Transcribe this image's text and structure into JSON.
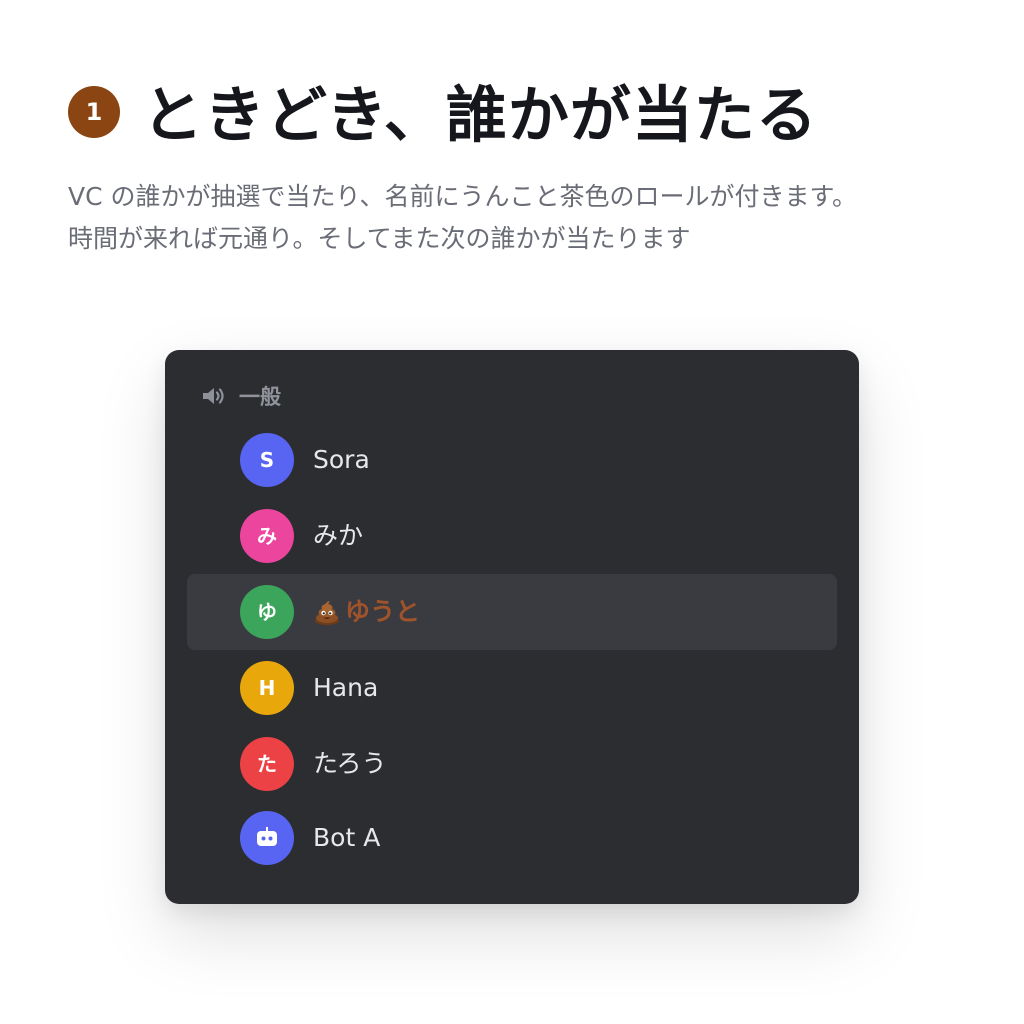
{
  "step": {
    "number": "1",
    "title": "ときどき、誰かが当たる",
    "description_lines": [
      "VC の誰かが抽選で当たり、名前にうんこと茶色のロールが付きます。",
      "時間が来れば元通り。そしてまた次の誰かが当たります"
    ]
  },
  "voice_channel": {
    "icon": "speaker-icon",
    "name": "一般",
    "members": [
      {
        "avatar": "S",
        "name": "Sora",
        "avatar_color": "#5865f2",
        "highlighted": false
      },
      {
        "avatar": "み",
        "name": "みか",
        "avatar_color": "#eb459e",
        "highlighted": false
      },
      {
        "avatar": "ゆ",
        "name": "ゆうと",
        "avatar_color": "#3ba55c",
        "highlighted": true,
        "prefix_icon": "poop-emoji-icon",
        "name_color": "#a0532a"
      },
      {
        "avatar": "H",
        "name": "Hana",
        "avatar_color": "#e8a80c",
        "highlighted": false
      },
      {
        "avatar": "た",
        "name": "たろう",
        "avatar_color": "#ed4245",
        "highlighted": false
      },
      {
        "avatar_icon": "bot-icon",
        "name": "Bot A",
        "avatar_color": "#5865f2",
        "highlighted": false
      }
    ]
  },
  "colors": {
    "badge": "#8a4513",
    "panel_background": "#2b2d31",
    "highlight_row": "#393b40",
    "role_brown": "#a0532a"
  }
}
